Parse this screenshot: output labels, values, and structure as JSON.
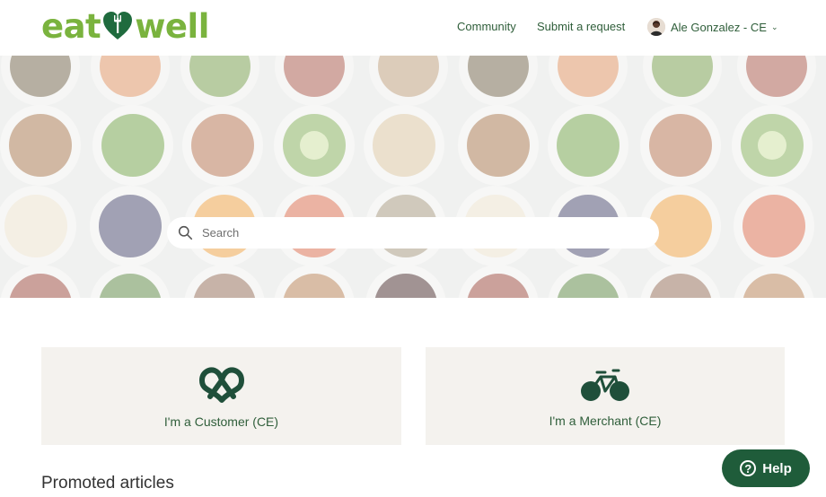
{
  "header": {
    "logo_left": "eat",
    "logo_right": "well",
    "nav": {
      "community": "Community",
      "submit_request": "Submit a request"
    },
    "user": {
      "name": "Ale Gonzalez - CE",
      "caret": "⌄"
    }
  },
  "hero": {
    "search": {
      "placeholder": "Search",
      "value": ""
    }
  },
  "cards": {
    "customer": {
      "label": "I'm a Customer (CE)",
      "icon": "pretzel-icon"
    },
    "merchant": {
      "label": "I'm a Merchant (CE)",
      "icon": "bicycle-icon"
    }
  },
  "section": {
    "title": "Promoted articles"
  },
  "help": {
    "label": "Help",
    "icon": "question-icon"
  },
  "colors": {
    "brand_green": "#7ab33e",
    "dark_green": "#1f5c3a",
    "card_bg": "#f4f2ee"
  }
}
